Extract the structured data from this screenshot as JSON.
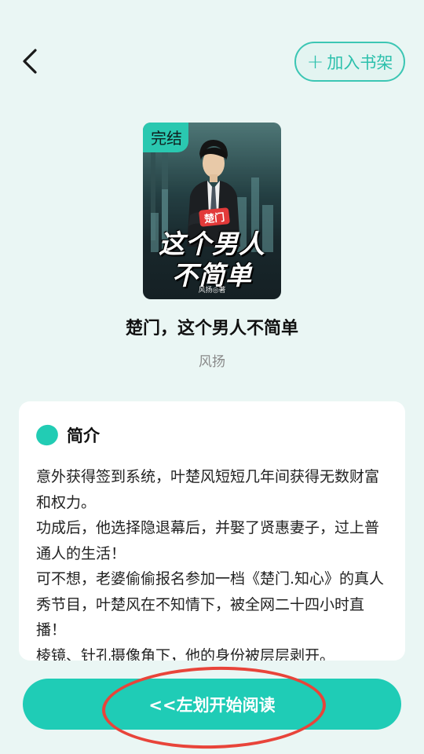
{
  "header": {
    "back_icon": "chevron-left-icon",
    "add_shelf_label": "加入书架",
    "add_shelf_icon": "plus-icon"
  },
  "cover": {
    "status_badge": "完结",
    "series_badge": "楚门",
    "title_line1": "这个男人",
    "title_line2": "不简单",
    "author_mark": "风扬◎著"
  },
  "book": {
    "title": "楚门，这个男人不简单",
    "author": "风扬"
  },
  "intro": {
    "heading": "简介",
    "paragraphs": [
      "意外获得签到系统，叶楚风短短几年间获得无数财富和权力。",
      "功成后，他选择隐退幕后，并娶了贤惠妻子，过上普通人的生活！",
      "可不想，老婆偷偷报名参加一档《楚门.知心》的真人秀节目，叶楚风在不知情下，被全网二十四小时直播！",
      "棱镜、针孔摄像角下，他的身份被层层剥开。"
    ]
  },
  "footer": {
    "read_label": "<<左划开始阅读"
  },
  "colors": {
    "accent": "#1fccb6",
    "background": "#eaf6f4",
    "annotation": "#e8443a"
  }
}
